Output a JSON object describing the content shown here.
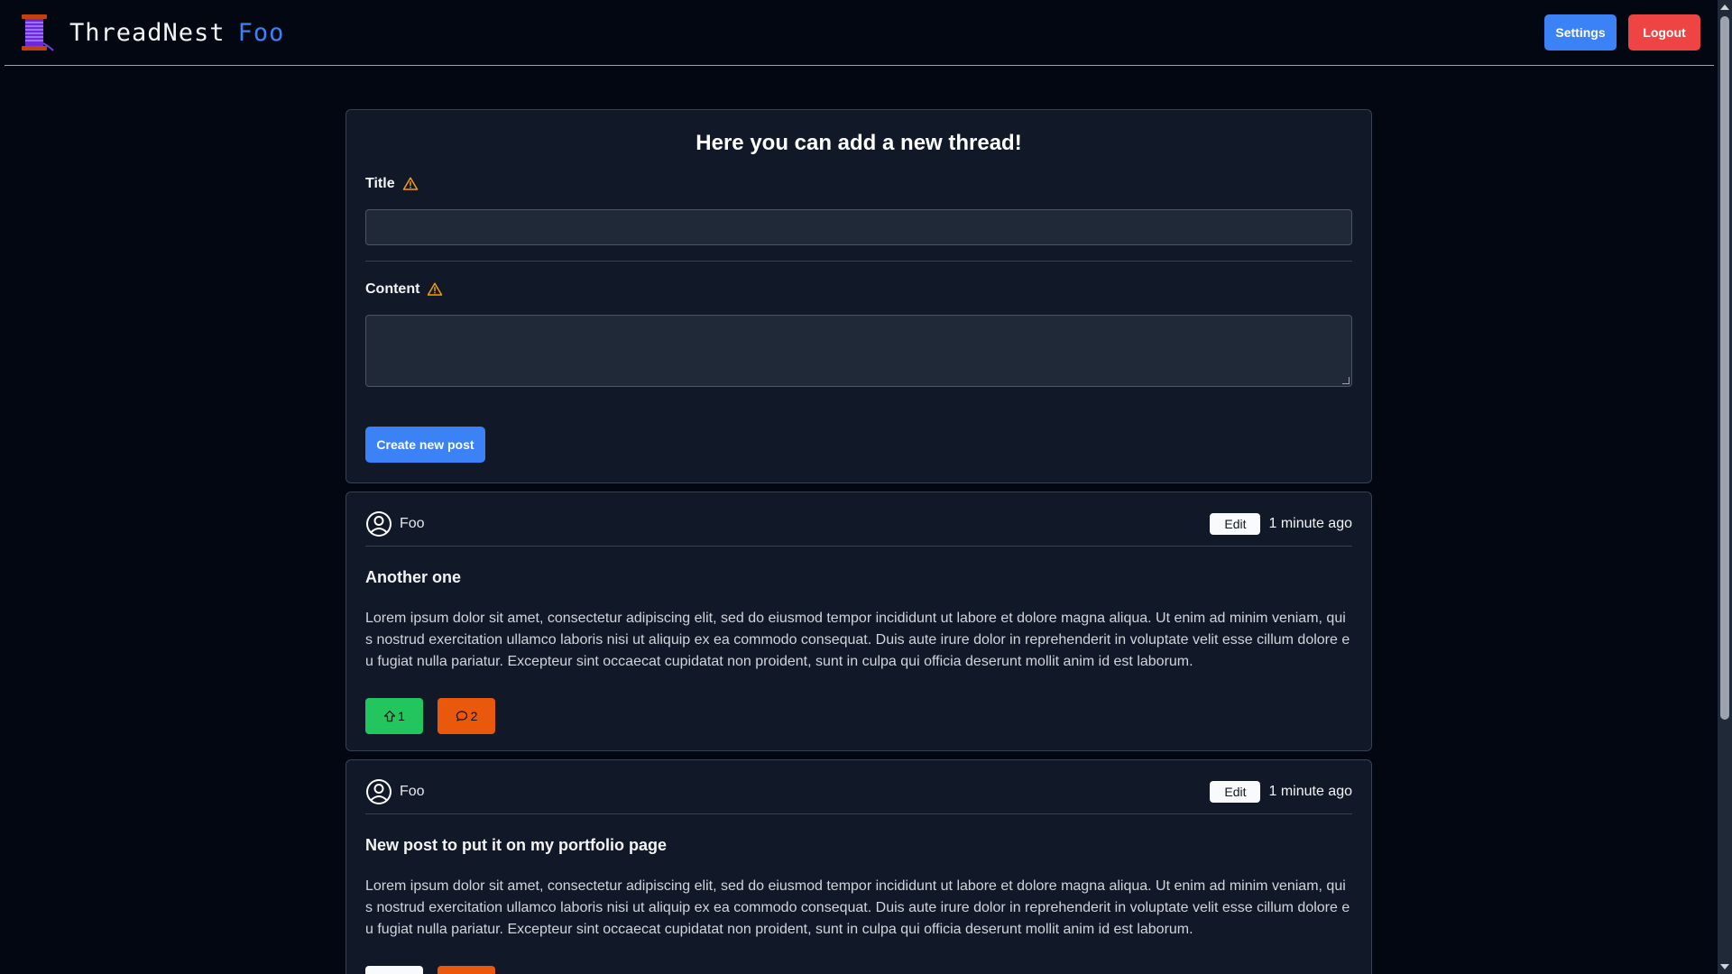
{
  "app": {
    "brand_name": "ThreadNest",
    "current_user": "Foo",
    "logo_icon": "thread-spool-icon"
  },
  "header": {
    "settings_label": "Settings",
    "logout_label": "Logout"
  },
  "new_thread_form": {
    "heading": "Here you can add a new thread!",
    "title_label": "Title",
    "title_value": "",
    "content_label": "Content",
    "content_value": "",
    "warning_icon": "warning-triangle-icon",
    "submit_label": "Create new post"
  },
  "posts": [
    {
      "author": "Foo",
      "edit_label": "Edit",
      "time": "1 minute ago",
      "title": "Another one",
      "body": "Lorem ipsum dolor sit amet, consectetur adipiscing elit, sed do eiusmod tempor incididunt ut labore et dolore magna aliqua. Ut enim ad minim veniam, quis nostrud exercitation ullamco laboris nisi ut aliquip ex ea commodo consequat. Duis aute irure dolor in reprehenderit in voluptate velit esse cillum dolore eu fugiat nulla pariatur. Excepteur sint occaecat cupidatat non proident, sunt in culpa qui officia deserunt mollit anim id est laborum.",
      "upvotes": "1",
      "comments": "2",
      "upvoted": true
    },
    {
      "author": "Foo",
      "edit_label": "Edit",
      "time": "1 minute ago",
      "title": "New post to put it on my portfolio page",
      "body": "Lorem ipsum dolor sit amet, consectetur adipiscing elit, sed do eiusmod tempor incididunt ut labore et dolore magna aliqua. Ut enim ad minim veniam, quis nostrud exercitation ullamco laboris nisi ut aliquip ex ea commodo consequat. Duis aute irure dolor in reprehenderit in voluptate velit esse cillum dolore eu fugiat nulla pariatur. Excepteur sint occaecat cupidatat non proident, sunt in culpa qui officia deserunt mollit anim id est laborum.",
      "upvoted": false
    }
  ],
  "colors": {
    "background": "#030712",
    "card": "#111827",
    "primary": "#3b82f6",
    "danger": "#ef4444",
    "upvote": "#22c55e",
    "comments": "#ea580c",
    "warning": "#f59e0b"
  }
}
